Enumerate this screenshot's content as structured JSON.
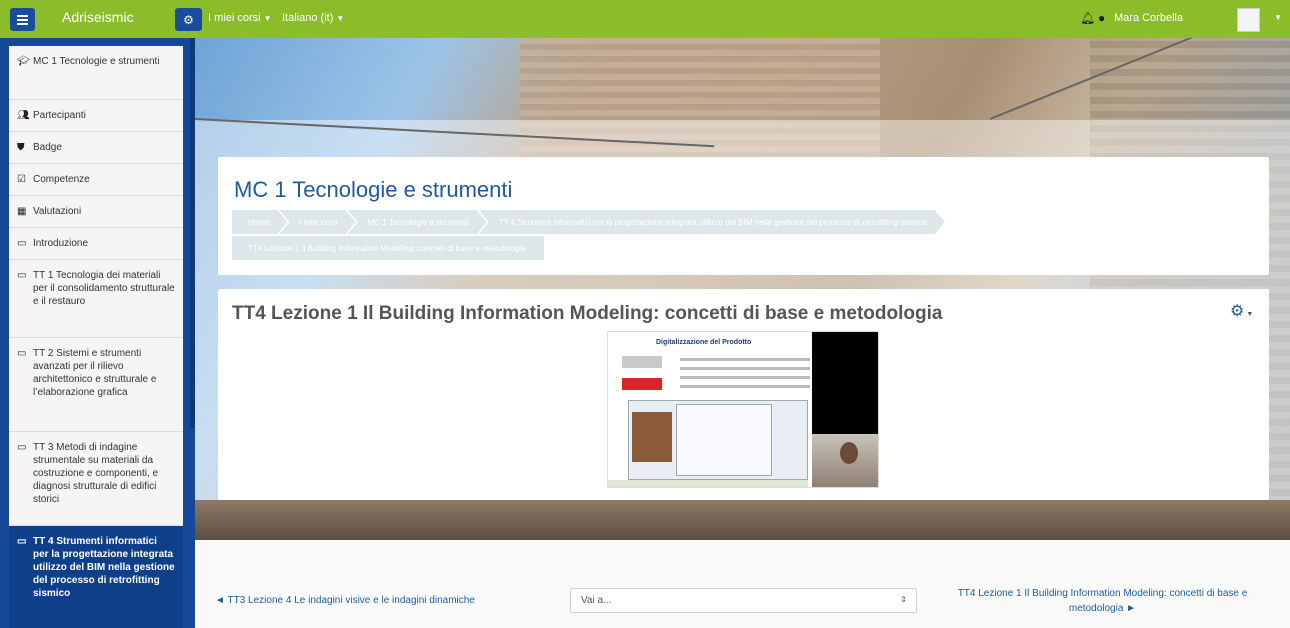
{
  "navbar": {
    "brand": "Adriseismic",
    "menu_courses": "I miei corsi",
    "menu_language": "Italiano (it)",
    "user_name": "Mara Corbella"
  },
  "colors": {
    "navbar": "#8bbd2a",
    "drawer": "#164a96",
    "link": "#1f5a9e"
  },
  "drawer": {
    "items": [
      {
        "icon": "graduation-cap-icon",
        "label": "MC 1 Tecnologie e strumenti"
      },
      {
        "icon": "users-icon",
        "label": "Partecipanti"
      },
      {
        "icon": "shield-icon",
        "label": "Badge"
      },
      {
        "icon": "checkbox-icon",
        "label": "Competenze"
      },
      {
        "icon": "table-icon",
        "label": "Valutazioni"
      },
      {
        "icon": "folder-icon",
        "label": "Introduzione"
      },
      {
        "icon": "folder-icon",
        "label": "TT 1 Tecnologia dei materiali per il consolidamento strutturale e il restauro"
      },
      {
        "icon": "folder-icon",
        "label": "TT 2 Sistemi e strumenti avanzati per il rilievo architettonico e strutturale e l’elaborazione grafica"
      },
      {
        "icon": "folder-icon",
        "label": "TT 3 Metodi di indagine strumentale su materiali da costruzione e componenti, e diagnosi strutturale di edifici storici"
      },
      {
        "icon": "folder-icon",
        "label": "TT 4 Strumenti informatici per la progettazione integrata utilizzo del BIM nella gestione del processo di retrofitting sismico"
      }
    ]
  },
  "header": {
    "title": "MC 1 Tecnologie e strumenti",
    "breadcrumb": [
      "Home",
      "I miei corsi",
      "MC 1 Tecnologie e strumenti",
      "TT 4 Strumenti informatici per la progettazione integrata utilizzo del BIM nella gestione del processo di retrofitting sismico",
      "TT4 Lezione 1 Il Building Information Modeling: concetti di base e metodologia"
    ]
  },
  "content": {
    "title": "TT4 Lezione 1 Il Building Information Modeling: concetti di base e metodologia",
    "video_slide_title": "Digitalizzazione del Prodotto"
  },
  "bottom_nav": {
    "prev": "◄ TT3 Lezione 4 Le indagini visive e le indagini dinamiche",
    "jump_placeholder": "Vai a...",
    "next": "TT4 Lezione 1 Il Building Information Modeling: concetti di base e metodologia ►"
  }
}
